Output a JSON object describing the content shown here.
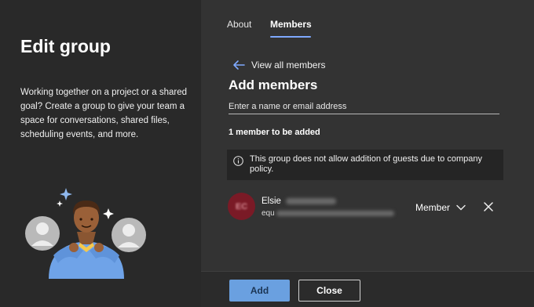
{
  "left_panel": {
    "title": "Edit group",
    "description": "Working together on a project or a shared goal? Create a group to give your team a space for conversations, shared files, scheduling events, and more."
  },
  "tabs": [
    {
      "label": "About",
      "active": false
    },
    {
      "label": "Members",
      "active": true
    }
  ],
  "nav": {
    "back_label": "View all members",
    "back_icon": "arrow-left-icon"
  },
  "add_members": {
    "title": "Add members",
    "search_placeholder": "Enter a name or email address",
    "count_text": "1 member to be added",
    "notice": "This group does not allow addition of guests due to company policy.",
    "notice_icon": "info-icon"
  },
  "member": {
    "initials": "EC",
    "name": "Elsie",
    "email_prefix": "equ",
    "role": "Member",
    "role_icon": "chevron-down-icon",
    "remove_icon": "close-icon"
  },
  "footer": {
    "add_label": "Add",
    "close_label": "Close"
  },
  "colors": {
    "accent": "#7fa9ff",
    "primary_button": "#6aa0e0",
    "avatar_bg": "#7a1a26",
    "panel_left": "#292929",
    "panel_right": "#333333"
  }
}
